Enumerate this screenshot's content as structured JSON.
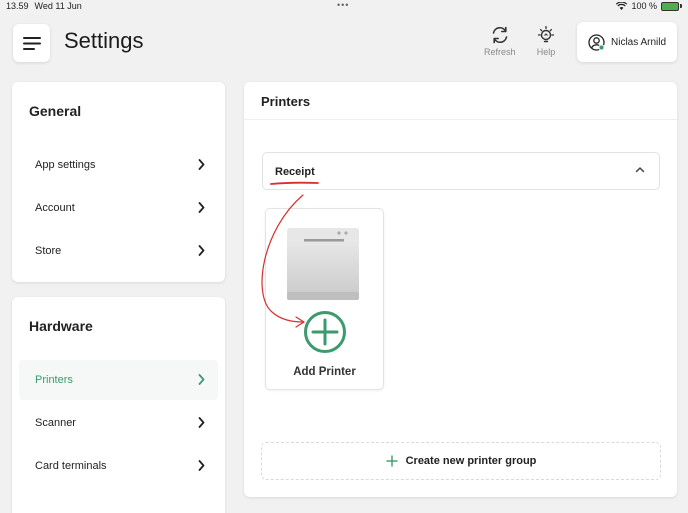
{
  "statusbar": {
    "time": "13.59",
    "date": "Wed 11 Jun",
    "battery": "100 %"
  },
  "header": {
    "title": "Settings",
    "refresh_label": "Refresh",
    "help_label": "Help",
    "user_name": "Niclas Arnild"
  },
  "sidebar": {
    "general_title": "General",
    "general_items": [
      {
        "label": "App settings"
      },
      {
        "label": "Account"
      },
      {
        "label": "Store"
      }
    ],
    "hardware_title": "Hardware",
    "hardware_items": [
      {
        "label": "Printers",
        "active": true
      },
      {
        "label": "Scanner"
      },
      {
        "label": "Card terminals"
      }
    ]
  },
  "main": {
    "title": "Printers",
    "group_label": "Receipt",
    "add_printer_label": "Add Printer",
    "create_group_label": "Create new printer group"
  },
  "colors": {
    "accent": "#3b9a6e",
    "annotation": "#d62f2f"
  }
}
